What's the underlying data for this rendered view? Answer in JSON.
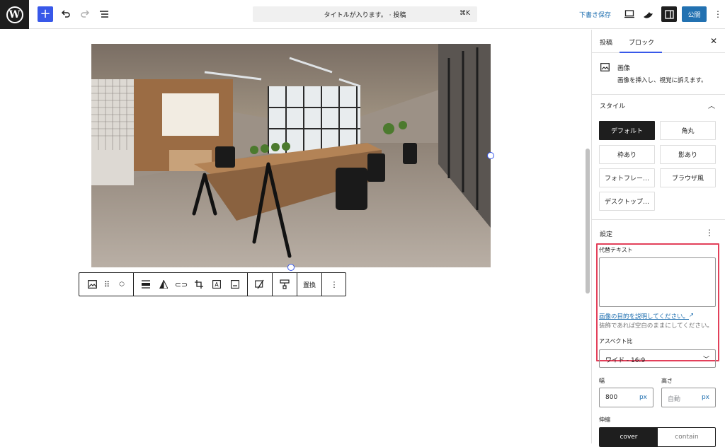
{
  "topbar": {
    "document_title": "タイトルが入ります。 · 投稿",
    "shortcut": "⌘K",
    "save_draft": "下書き保存",
    "publish": "公開"
  },
  "block_toolbar": {
    "replace_label": "置換"
  },
  "sidebar": {
    "tabs": [
      "投稿",
      "ブロック"
    ],
    "active_tab": "ブロック",
    "block": {
      "name": "画像",
      "description": "画像を挿入し、視覚に訴えます。"
    },
    "styles": {
      "title": "スタイル",
      "options": [
        "デフォルト",
        "角丸",
        "枠あり",
        "影あり",
        "フォトフレー…",
        "ブラウザ風",
        "デスクトップ…"
      ],
      "active": "デフォルト"
    },
    "settings": {
      "title": "設定",
      "alt_text_label": "代替テキスト",
      "alt_text_value": "",
      "alt_help_link": "画像の目的を説明してください。",
      "alt_help_text": "装飾であれば空白のままにしてください。",
      "aspect_label": "アスペクト比",
      "aspect_value": "ワイド - 16:9",
      "width_label": "幅",
      "width_value": "800",
      "width_unit": "px",
      "height_label": "高さ",
      "height_placeholder": "自動",
      "height_unit": "px",
      "scale_label": "伸縮",
      "scale_options": [
        "cover",
        "contain"
      ],
      "scale_active": "cover"
    }
  },
  "colors": {
    "accent": "#3858e9",
    "wp_blue": "#2271b1",
    "highlight": "#e3405a",
    "dark": "#1e1e1e"
  }
}
